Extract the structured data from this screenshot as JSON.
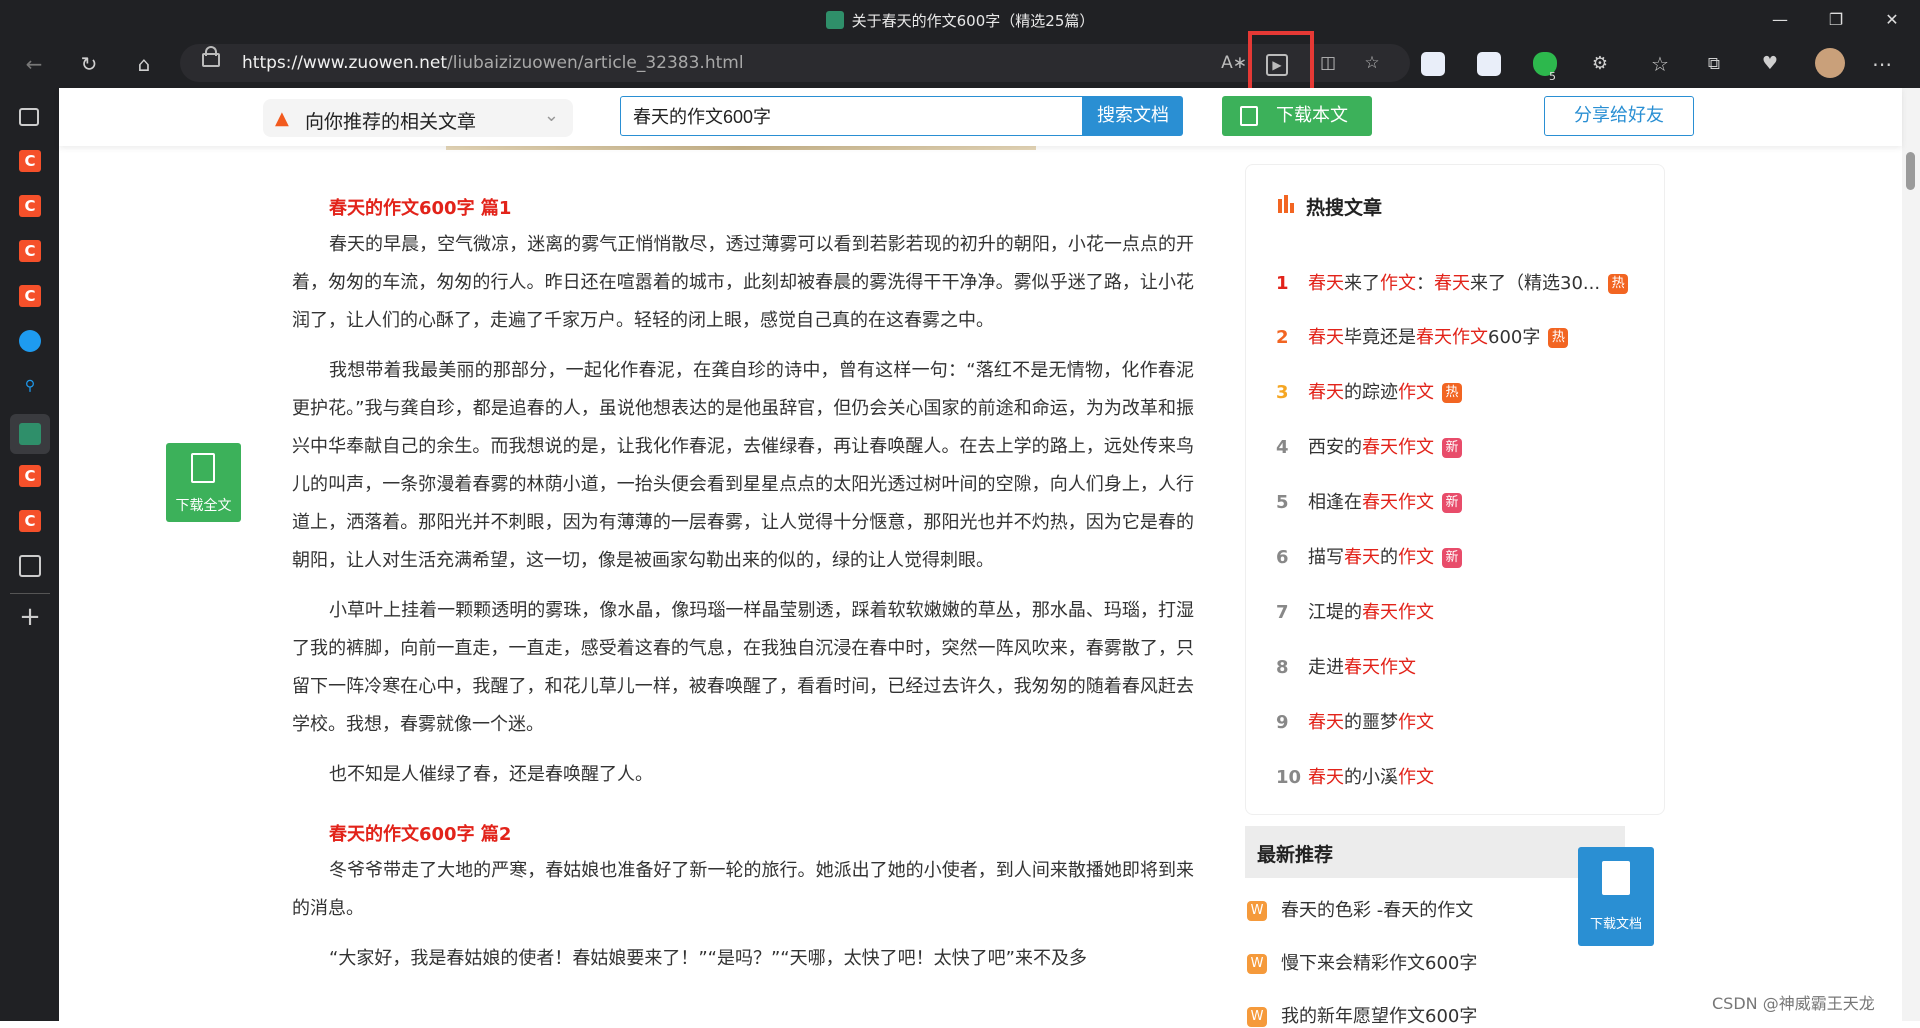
{
  "window": {
    "title": "关于春天的作文600字（精选25篇）"
  },
  "toolbar": {
    "url_host": "https://www.zuowen.net",
    "url_path": "/liubaizizuowen/article_32383.html",
    "extension_badge": "5"
  },
  "sticky_header": {
    "related_label": "向你推荐的相关文章",
    "search_value": "春天的作文600字",
    "search_button": "搜索文档",
    "download_button": "下载本文",
    "share_button": "分享给好友"
  },
  "floating_download": {
    "label": "下载全文"
  },
  "article": {
    "section1_title": "春天的作文600字 篇1",
    "p1": "春天的早晨，空气微凉，迷离的雾气正悄悄散尽，透过薄雾可以看到若影若现的初升的朝阳，小花一点点的开着，匆匆的车流，匆匆的行人。昨日还在喧嚣着的城市，此刻却被春晨的雾洗得干干净净。雾似乎迷了路，让小花润了，让人们的心酥了，走遍了千家万户。轻轻的闭上眼，感觉自己真的在这春雾之中。",
    "p2": "我想带着我最美丽的那部分，一起化作春泥，在龚自珍的诗中，曾有这样一句：“落红不是无情物，化作春泥更护花。”我与龚自珍，都是追春的人，虽说他想表达的是他虽辞官，但仍会关心国家的前途和命运，为为改革和振兴中华奉献自己的余生。而我想说的是，让我化作春泥，去催绿春，再让春唤醒人。在去上学的路上，远处传来鸟儿的叫声，一条弥漫着春雾的林荫小道，一抬头便会看到星星点点的太阳光透过树叶间的空隙，向人们身上，人行道上，洒落着。那阳光并不刺眼，因为有薄薄的一层春雾，让人觉得十分惬意，那阳光也并不灼热，因为它是春的朝阳，让人对生活充满希望，这一切，像是被画家勾勒出来的似的，绿的让人觉得刺眼。",
    "p3": "小草叶上挂着一颗颗透明的雾珠，像水晶，像玛瑙一样晶莹剔透，踩着软软嫩嫩的草丛，那水晶、玛瑙，打湿了我的裤脚，向前一直走，一直走，感受着这春的气息，在我独自沉浸在春中时，突然一阵风吹来，春雾散了，只留下一阵冷寒在心中，我醒了，和花儿草儿一样，被春唤醒了，看看时间，已经过去许久，我匆匆的随着春风赶去学校。我想，春雾就像一个迷。",
    "p4": "也不知是人催绿了春，还是春唤醒了人。",
    "section2_title": "春天的作文600字 篇2",
    "p5": "冬爷爷带走了大地的严寒，春姑娘也准备好了新一轮的旅行。她派出了她的小使者，到人间来散播她即将到来的消息。",
    "p6": "“大家好，我是春姑娘的使者！春姑娘要来了！”“是吗？”“天哪，太快了吧！太快了吧”来不及多"
  },
  "hot_panel": {
    "title": "热搜文章",
    "items": [
      {
        "num": "1",
        "parts": [
          [
            "春天",
            true
          ],
          [
            "来了",
            false
          ],
          [
            "作文",
            true
          ],
          [
            "：",
            false
          ],
          [
            "春天",
            true
          ],
          [
            "来了（精选30...",
            false
          ]
        ],
        "badge": "热",
        "badge_type": "hot",
        "num_color": "#e2231a"
      },
      {
        "num": "2",
        "parts": [
          [
            "春天",
            true
          ],
          [
            "毕竟还是",
            false
          ],
          [
            "春天作文",
            true
          ],
          [
            "600字",
            false
          ]
        ],
        "badge": "热",
        "badge_type": "hot",
        "num_color": "#f26522"
      },
      {
        "num": "3",
        "parts": [
          [
            "春天",
            true
          ],
          [
            "的踪迹",
            false
          ],
          [
            "作文",
            true
          ]
        ],
        "badge": "热",
        "badge_type": "hot",
        "num_color": "#f5a623"
      },
      {
        "num": "4",
        "parts": [
          [
            "西安的",
            false
          ],
          [
            "春天作文",
            true
          ]
        ],
        "badge": "新",
        "badge_type": "new",
        "num_color": "#888888"
      },
      {
        "num": "5",
        "parts": [
          [
            "相逢在",
            false
          ],
          [
            "春天作文",
            true
          ]
        ],
        "badge": "新",
        "badge_type": "new",
        "num_color": "#888888"
      },
      {
        "num": "6",
        "parts": [
          [
            "描写",
            false
          ],
          [
            "春天",
            true
          ],
          [
            "的",
            false
          ],
          [
            "作文",
            true
          ]
        ],
        "badge": "新",
        "badge_type": "new",
        "num_color": "#888888"
      },
      {
        "num": "7",
        "parts": [
          [
            "江堤的",
            false
          ],
          [
            "春天作文",
            true
          ]
        ],
        "badge": "",
        "badge_type": "",
        "num_color": "#888888"
      },
      {
        "num": "8",
        "parts": [
          [
            "走进",
            false
          ],
          [
            "春天作文",
            true
          ]
        ],
        "badge": "",
        "badge_type": "",
        "num_color": "#888888"
      },
      {
        "num": "9",
        "parts": [
          [
            "春天",
            true
          ],
          [
            "的噩梦",
            false
          ],
          [
            "作文",
            true
          ]
        ],
        "badge": "",
        "badge_type": "",
        "num_color": "#888888"
      },
      {
        "num": "10",
        "parts": [
          [
            "春天",
            true
          ],
          [
            "的小溪",
            false
          ],
          [
            "作文",
            true
          ]
        ],
        "badge": "",
        "badge_type": "",
        "num_color": "#888888"
      }
    ]
  },
  "latest_panel": {
    "title": "最新推荐",
    "items": [
      "春天的色彩 -春天的作文",
      "慢下来会精彩作文600字",
      "我的新年愿望作文600字"
    ],
    "badge": "W"
  },
  "floating_download2": {
    "label": "下载文档"
  },
  "watermark": "CSDN @神威霸王天龙",
  "colors": {
    "accent_blue": "#2a8fd3",
    "download_green": "#3cb15a",
    "keyword_red": "#e2231a",
    "annotation_red": "#e53935"
  }
}
